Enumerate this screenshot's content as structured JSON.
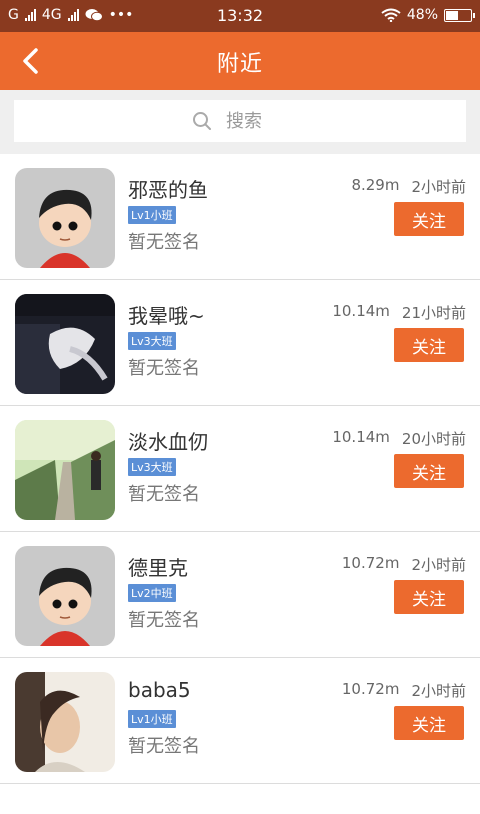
{
  "status_bar": {
    "carrier_1": "G",
    "carrier_2": "4G",
    "more": "•••",
    "time": "13:32",
    "battery": "48%",
    "battery_level": 0.48
  },
  "nav": {
    "title": "附近"
  },
  "search": {
    "placeholder": "搜索"
  },
  "users": [
    {
      "name": "邪恶的鱼",
      "level": "Lv1小班",
      "signature": "暂无签名",
      "distance": "8.29m",
      "time": "2小时前",
      "follow_label": "关注"
    },
    {
      "name": "我晕哦~",
      "level": "Lv3大班",
      "signature": "暂无签名",
      "distance": "10.14m",
      "time": "21小时前",
      "follow_label": "关注"
    },
    {
      "name": "淡水血仞",
      "level": "Lv3大班",
      "signature": "暂无签名",
      "distance": "10.14m",
      "time": "20小时前",
      "follow_label": "关注"
    },
    {
      "name": "德里克",
      "level": "Lv2中班",
      "signature": "暂无签名",
      "distance": "10.72m",
      "time": "2小时前",
      "follow_label": "关注"
    },
    {
      "name": "baba5",
      "level": "Lv1小班",
      "signature": "暂无签名",
      "distance": "10.72m",
      "time": "2小时前",
      "follow_label": "关注"
    }
  ]
}
